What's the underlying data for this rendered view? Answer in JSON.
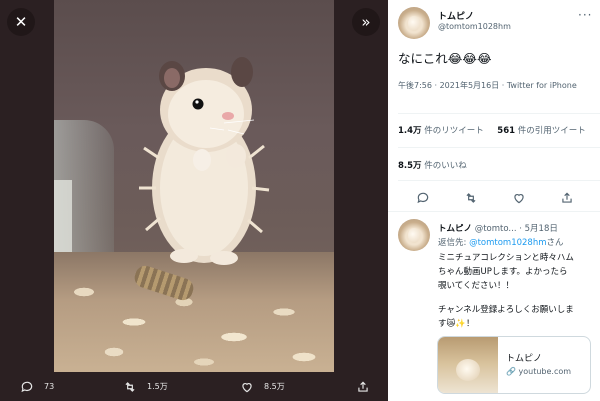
{
  "media_viewer": {
    "close_icon": "close-icon",
    "expand_icon": "double-chevron-right-icon",
    "actions": [
      {
        "icon": "reply-icon",
        "count": "73"
      },
      {
        "icon": "retweet-icon",
        "count": "1.5万"
      },
      {
        "icon": "like-icon",
        "count": "8.5万"
      },
      {
        "icon": "share-icon",
        "count": ""
      }
    ]
  },
  "tweet": {
    "author_name": "トムピノ",
    "author_handle": "@tomtom1028hm",
    "more_icon": "more-icon",
    "text": "なにこれ😂😂😂",
    "timestamp": "午後7:56 · 2021年5月16日 · Twitter for iPhone",
    "retweets": {
      "count": "1.4万",
      "label": "件のリツイート"
    },
    "quotes": {
      "count": "561",
      "label": "件の引用ツイート"
    },
    "likes": {
      "count": "8.5万",
      "label": "件のいいね"
    },
    "actions": [
      "reply-icon",
      "retweet-icon",
      "like-icon",
      "share-icon"
    ]
  },
  "reply": {
    "author_name": "トムピノ",
    "author_handle": "@tomto...",
    "date": "· 5月18日",
    "reply_to_label": "返信先:",
    "reply_to_handle": "@tomtom1028hm",
    "reply_to_suffix": "さん",
    "lines": [
      "ミニチュアコレクションと時々ハム",
      "ちゃん動画UPします。よかったら",
      "覗いてください！！",
      "",
      "チャンネル登録よろしくお願いしま",
      "す😿✨！"
    ],
    "card": {
      "title": "トムピノ",
      "domain": "youtube.com",
      "link_icon": "link-icon"
    }
  },
  "colors": {
    "accent": "#1d9bf0",
    "text": "#0f1419",
    "muted": "#536471"
  }
}
